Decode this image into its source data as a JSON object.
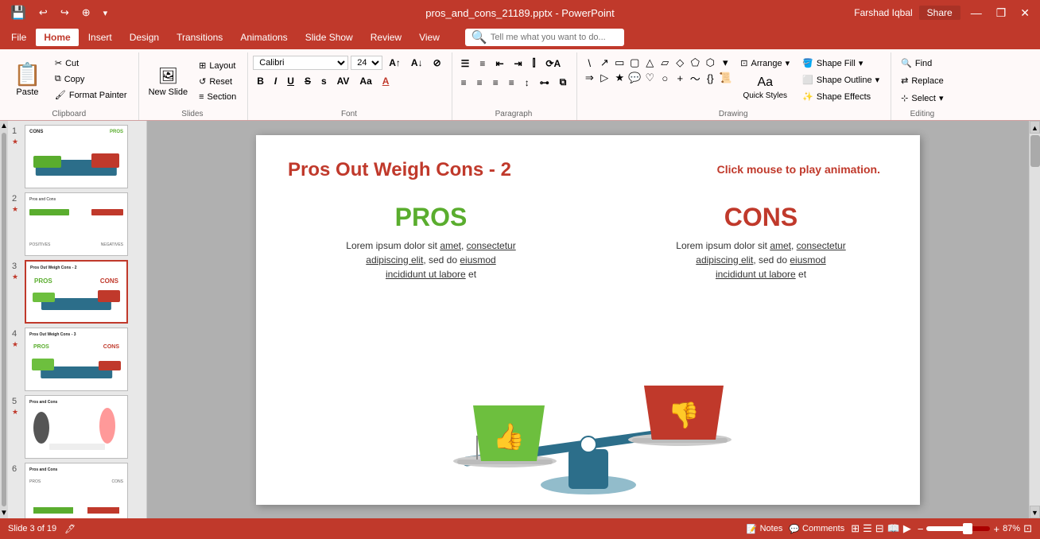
{
  "titlebar": {
    "filename": "pros_and_cons_21189.pptx - PowerPoint",
    "quick_access": [
      "save",
      "undo",
      "redo",
      "customize"
    ],
    "window_controls": [
      "minimize",
      "restore",
      "close"
    ],
    "user": "Farshad Iqbal",
    "share_label": "Share"
  },
  "menubar": {
    "tabs": [
      "File",
      "Home",
      "Insert",
      "Design",
      "Transitions",
      "Animations",
      "Slide Show",
      "Review",
      "View"
    ],
    "active_tab": "Home",
    "search_placeholder": "Tell me what you want to do..."
  },
  "ribbon": {
    "clipboard": {
      "label": "Clipboard",
      "paste_label": "Paste",
      "cut_label": "Cut",
      "copy_label": "Copy",
      "format_painter_label": "Format Painter"
    },
    "slides": {
      "label": "Slides",
      "new_slide_label": "New Slide",
      "layout_label": "Layout",
      "reset_label": "Reset",
      "section_label": "Section"
    },
    "font": {
      "label": "Font",
      "font_name": "Calibri",
      "font_size": "24",
      "bold": "B",
      "italic": "I",
      "underline": "U",
      "strikethrough": "S",
      "shadow": "s",
      "char_spacing": "A",
      "font_color": "A"
    },
    "paragraph": {
      "label": "Paragraph"
    },
    "drawing": {
      "label": "Drawing",
      "arrange_label": "Arrange",
      "quick_styles_label": "Quick Styles",
      "shape_fill_label": "Shape Fill",
      "shape_outline_label": "Shape Outline",
      "shape_effects_label": "Shape Effects"
    },
    "editing": {
      "label": "Editing",
      "find_label": "Find",
      "replace_label": "Replace",
      "select_label": "Select"
    }
  },
  "slide_panel": {
    "slides": [
      {
        "num": "1",
        "starred": true
      },
      {
        "num": "2",
        "starred": true
      },
      {
        "num": "3",
        "starred": true,
        "active": true
      },
      {
        "num": "4",
        "starred": true
      },
      {
        "num": "5",
        "starred": true
      },
      {
        "num": "6",
        "starred": false
      }
    ]
  },
  "slide": {
    "title_prefix": "Pros Out Weigh Cons - ",
    "title_number": "2",
    "click_hint": "Click mouse to play animation.",
    "pros": {
      "label": "PROS",
      "text": "Lorem ipsum dolor sit amet, consectetur adipiscing elit, sed do eiusmod incididunt ut labore et"
    },
    "cons": {
      "label": "CONS",
      "text": "Lorem ipsum dolor sit amet, consectetur adipiscing elit, sed do eiusmod incididunt ut labore et"
    }
  },
  "statusbar": {
    "slide_info": "Slide 3 of 19",
    "notes_label": "Notes",
    "comments_label": "Comments",
    "view_icons": [
      "normal",
      "outline",
      "slide-sorter",
      "reading",
      "presenter"
    ],
    "zoom_level": "87%",
    "fit_label": "Fit"
  },
  "colors": {
    "accent_red": "#c0392b",
    "pros_green": "#5aad2e",
    "cons_red": "#c0392b",
    "scale_teal": "#2c6e8a",
    "pros_box_green": "#6dbf3e",
    "cons_box_red": "#c0392b"
  }
}
